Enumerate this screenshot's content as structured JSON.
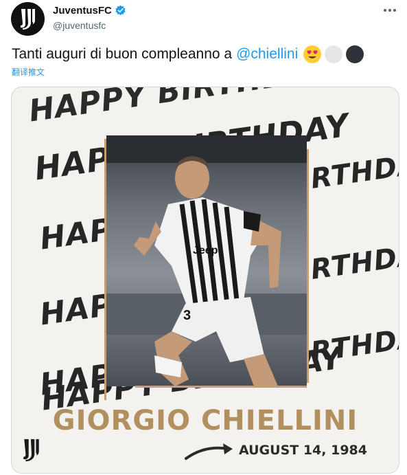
{
  "account": {
    "display_name": "JuventusFC",
    "handle": "@juventusfc"
  },
  "tweet": {
    "text": "Tanti auguri di buon compleanno a",
    "mention": "@chiellini",
    "emojis": [
      "heart-eyes-emoji",
      "white-circle-emoji",
      "black-circle-emoji"
    ],
    "translate_label": "翻译推文"
  },
  "card": {
    "bg_words": [
      {
        "text": "HAPPY BIRTHDAY"
      },
      {
        "text": "HAPPY BIRTHDAY"
      },
      {
        "text": "HAPPY"
      },
      {
        "text": "BIRTHDAY"
      },
      {
        "text": "HAPPY"
      },
      {
        "text": "BIRTHDAY"
      },
      {
        "text": "HAPPY"
      },
      {
        "text": "BIRTHDAY"
      },
      {
        "text": "HAPPY BIRTHDAY"
      }
    ],
    "player_name": "GIORGIO CHIELLINI",
    "date": "AUGUST 14, 1984",
    "jersey_sponsor": "Jeep",
    "jersey_number": "3"
  },
  "colors": {
    "link": "#1d9bf0",
    "gold": "#b28f5e",
    "verified": "#1d9bf0"
  }
}
